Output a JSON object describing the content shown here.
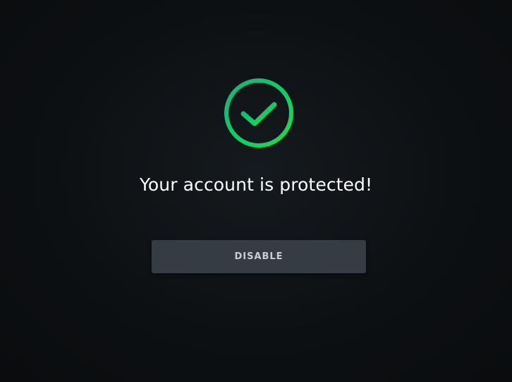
{
  "status": {
    "icon": "check-circle-icon",
    "message": "Your account is protected!",
    "gradient_start": "#0bb87e",
    "gradient_end": "#14e04e"
  },
  "actions": {
    "disable_label": "DISABLE"
  }
}
